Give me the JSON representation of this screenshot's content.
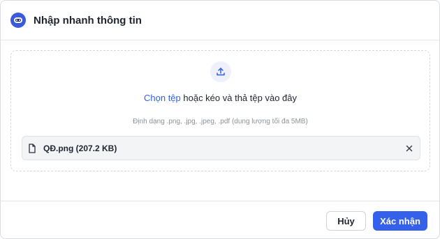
{
  "dialog": {
    "title": "Nhập nhanh thông tin",
    "logo_icon": "robot-icon",
    "brand_color": "#3b5bdb"
  },
  "upload": {
    "icon": "upload-icon",
    "link_label": "Chọn tệp",
    "instruction": " hoặc kéo và thả tệp vào đây",
    "hint": "Định dạng .png, .jpg, .jpeg, .pdf (dung lượng tối đa 5MB)",
    "link_color": "#2f5fe4"
  },
  "file": {
    "icon": "file-icon",
    "label": "QĐ.png (207.2 KB)",
    "remove_icon": "close-icon"
  },
  "footer": {
    "cancel_label": "Hủy",
    "confirm_label": "Xác nhận",
    "confirm_color": "#3561ea"
  }
}
